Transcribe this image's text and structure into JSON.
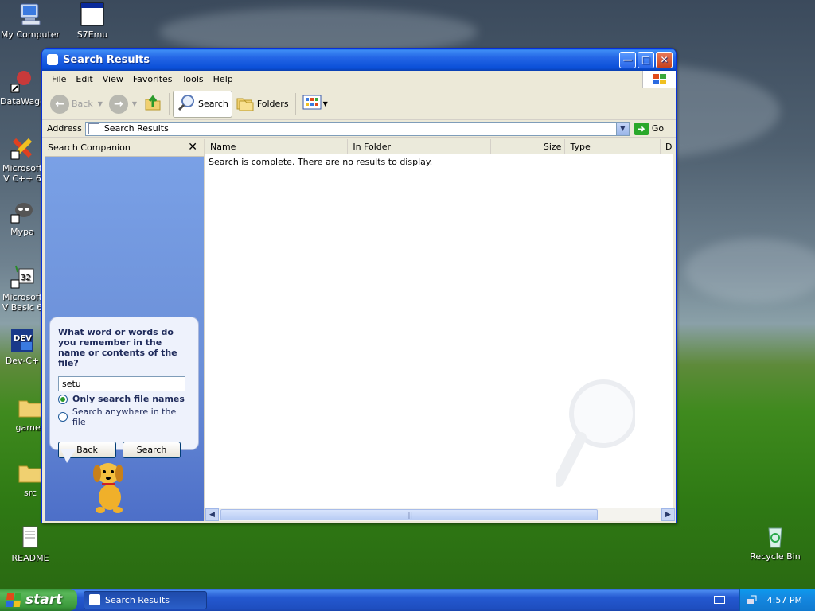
{
  "desktop": {
    "icons": [
      {
        "label": "My Computer"
      },
      {
        "label": "S7Emu"
      },
      {
        "label": "DataWago"
      },
      {
        "label": "Microsoft V C++ 6"
      },
      {
        "label": "Mypa"
      },
      {
        "label": "Microsoft V Basic 6"
      },
      {
        "label": "Dev-C+"
      },
      {
        "label": "games"
      },
      {
        "label": "src"
      },
      {
        "label": "README"
      },
      {
        "label": "Recycle Bin"
      }
    ]
  },
  "window": {
    "title": "Search Results",
    "menu": [
      "File",
      "Edit",
      "View",
      "Favorites",
      "Tools",
      "Help"
    ],
    "toolbar": {
      "back": "Back",
      "search": "Search",
      "folders": "Folders"
    },
    "address": {
      "label": "Address",
      "value": "Search Results",
      "go": "Go"
    },
    "companion": {
      "title": "Search Companion",
      "question": "What word or words do you remember in the name or contents of the file?",
      "input_value": "setu",
      "option_selected": "Only search file names",
      "option_other": "Search anywhere in the file",
      "back_button": "Back",
      "search_button": "Search"
    },
    "results": {
      "columns": [
        "Name",
        "In Folder",
        "Size",
        "Type",
        "D"
      ],
      "message": "Search is complete. There are no results to display."
    }
  },
  "taskbar": {
    "start": "start",
    "task": "Search Results",
    "clock": "4:57 PM"
  },
  "colors": {
    "titlebar": "#2466e6",
    "companion_bg": "#6b8fd8",
    "start_green": "#3c9a3c"
  }
}
